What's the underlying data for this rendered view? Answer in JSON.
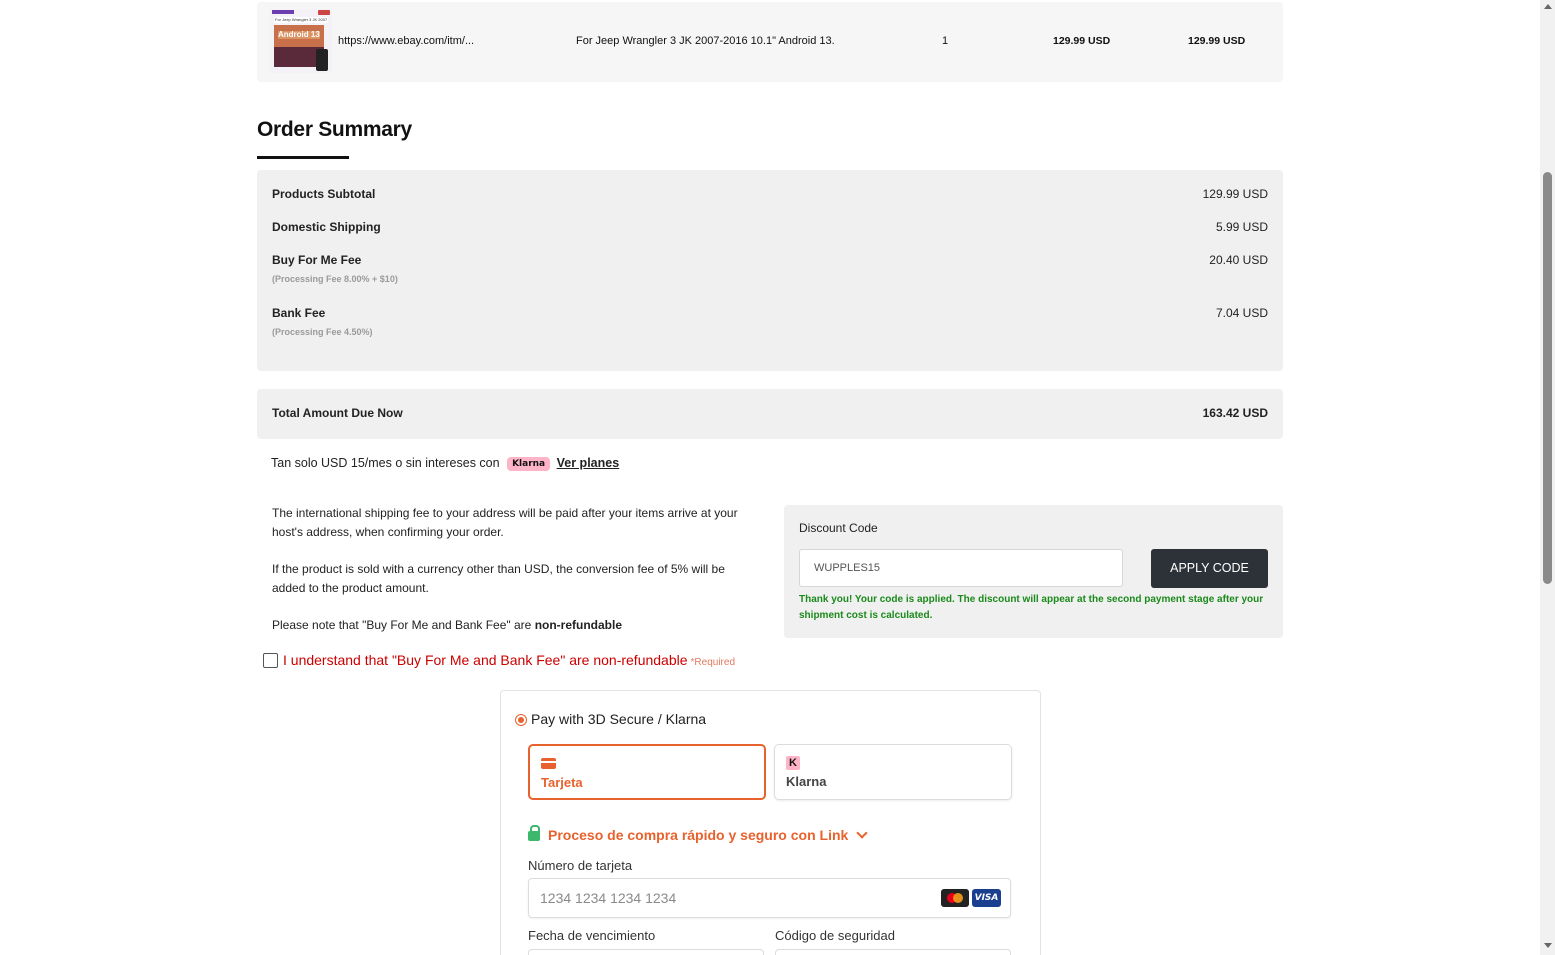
{
  "product": {
    "url": "https://www.ebay.com/itm/...",
    "title": "For Jeep Wrangler 3 JK 2007-2016 10.1\" Android 13.",
    "quantity": "1",
    "unit_price": "129.99 USD",
    "total_price": "129.99 USD",
    "thumb_text": "Android 13",
    "thumb_caption": "For Jeep Wrangler 3 JK 2007-2016"
  },
  "order_summary": {
    "title": "Order Summary",
    "rows": [
      {
        "label": "Products Subtotal",
        "value": "129.99 USD",
        "sub": ""
      },
      {
        "label": "Domestic Shipping",
        "value": "5.99 USD",
        "sub": ""
      },
      {
        "label": "Buy For Me Fee",
        "value": "20.40 USD",
        "sub": "(Processing Fee 8.00% + $10)"
      },
      {
        "label": "Bank Fee",
        "value": "7.04 USD",
        "sub": "(Processing Fee 4.50%)"
      }
    ],
    "total_label": "Total Amount Due Now",
    "total_value": "163.42 USD"
  },
  "klarna_promo": {
    "text": "Tan solo USD 15/mes o sin intereses con",
    "badge": "Klarna",
    "link": "Ver planes"
  },
  "notes": {
    "shipping": "The international shipping fee to your address will be paid after your items arrive at your host's address, when confirming your order.",
    "currency": "If the product is sold with a currency other than USD, the conversion fee of 5% will be added to the product amount.",
    "refund_prefix": "Please note that \"Buy For Me and Bank Fee\" are",
    "refund_bold": "non-refundable"
  },
  "agreement": {
    "label": "I understand that \"Buy For Me and Bank Fee\" are non-refundable",
    "required": "*Required",
    "checked": false
  },
  "discount": {
    "title": "Discount Code",
    "code_value": "WUPPLES15",
    "button": "APPLY CODE",
    "success": "Thank you! Your code is applied. The discount will appear at the second payment stage after your shipment cost is calculated."
  },
  "payment": {
    "method_label": "Pay with 3D Secure / Klarna",
    "tabs": [
      {
        "label": "Tarjeta",
        "icon": "credit-card-icon",
        "selected": true
      },
      {
        "label": "Klarna",
        "icon": "klarna-icon",
        "selected": false
      }
    ],
    "link_text": "Proceso de compra rápido y seguro con Link",
    "card_number_label": "Número de tarjeta",
    "card_number_placeholder": "1234 1234 1234 1234",
    "brand_visa": "VISA",
    "expiry_label": "Fecha de vencimiento",
    "cvc_label": "Código de seguridad"
  },
  "colors": {
    "accent": "#e8622d",
    "error": "#cc0000",
    "success": "#1a8a1a",
    "panel": "#f0f0f0",
    "button_dark": "#2d3138",
    "klarna_pink": "#ffb3c7"
  }
}
